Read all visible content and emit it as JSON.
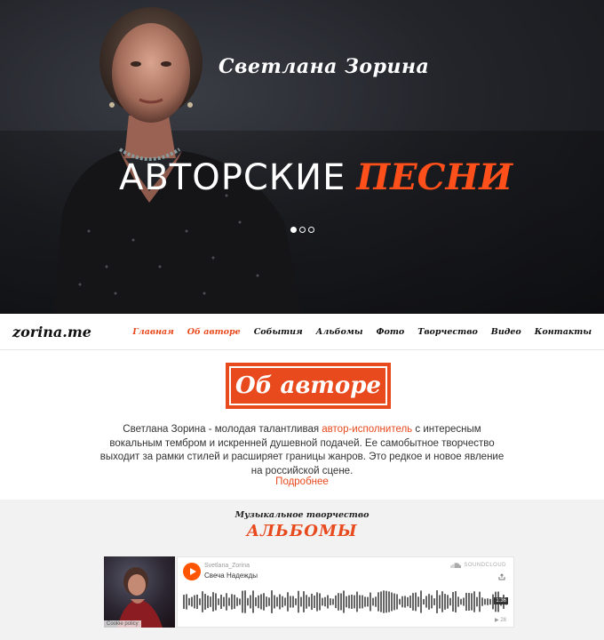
{
  "hero": {
    "artist_name": "Светлана Зорина",
    "headline_plain": "АВТОРСКИЕ",
    "headline_accent": "ПЕСНИ",
    "slider_dots": 3,
    "active_dot": 0
  },
  "nav": {
    "logo": "zorina.me",
    "items": [
      {
        "label": "Главная",
        "active": true
      },
      {
        "label": "Об авторе",
        "active": true
      },
      {
        "label": "События",
        "active": false
      },
      {
        "label": "Альбомы",
        "active": false
      },
      {
        "label": "Фото",
        "active": false
      },
      {
        "label": "Творчество",
        "active": false
      },
      {
        "label": "Видео",
        "active": false
      },
      {
        "label": "Контакты",
        "active": false
      }
    ]
  },
  "about": {
    "title": "Об авторе",
    "text_before": "Светлана Зорина - молодая талантливая ",
    "text_link": "автор-исполнитель",
    "text_after": " с интересным вокальным тембром и искренней душевной подачей. Ее самобытное творчество выходит за рамки стилей и расширяет границы жанров. Это редкое и новое явление на российской сцене.",
    "more_label": "Подробнее"
  },
  "albums": {
    "subtitle": "Музыкальное творчество",
    "title": "АЛЬБОМЫ",
    "cover_tag": "Cookie policy",
    "player": {
      "user": "Svetlana_Zorina",
      "track": "Свеча Надежды",
      "brand": "SOUNDCLOUD",
      "duration": "1:36",
      "plays": "▶ 28"
    }
  },
  "colors": {
    "accent": "#e8491d",
    "hero_accent": "#ff4f1a",
    "soundcloud": "#ff5500"
  }
}
